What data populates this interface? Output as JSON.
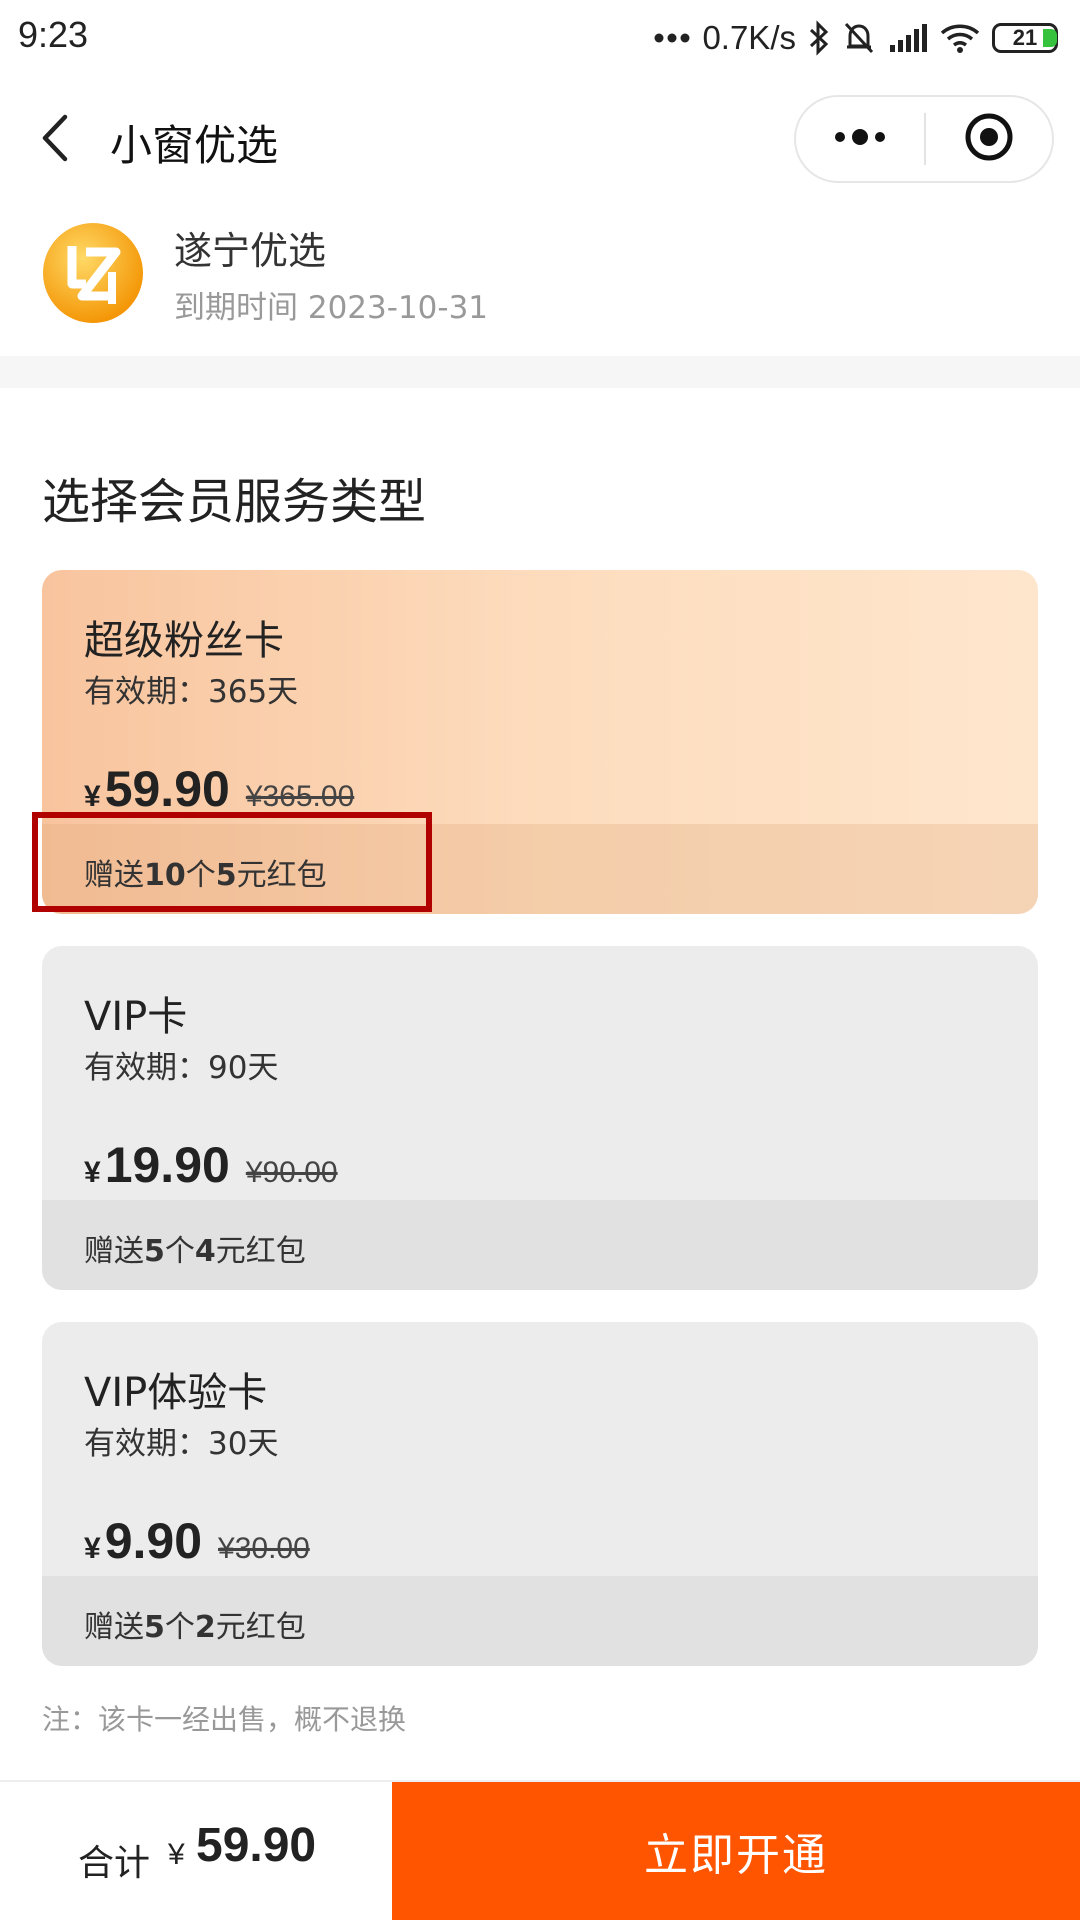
{
  "status_bar": {
    "time": "9:23",
    "network_speed": "0.7K/s",
    "battery_level": "21",
    "icons": [
      "more-dots-icon",
      "bluetooth-icon",
      "mute-icon",
      "signal-icon",
      "wifi-icon",
      "battery-icon"
    ]
  },
  "nav": {
    "title": "小窗优选",
    "back_icon": "chevron-left-icon",
    "more_icon": "more-dots-icon",
    "close_icon": "target-circle-icon"
  },
  "shop": {
    "name": "遂宁优选",
    "expire_label": "到期时间",
    "expire_date": "2023-10-31",
    "logo_colors": [
      "#f9b233",
      "#f39200"
    ]
  },
  "section_title": "选择会员服务类型",
  "cards": [
    {
      "name": "超级粉丝卡",
      "validity": "有效期：365天",
      "currency": "¥",
      "price": "59.90",
      "original_price": "¥365.00",
      "gift": {
        "prefix": "赠送",
        "count": "10",
        "mid": "个",
        "amount": "5",
        "suffix": "元红包"
      },
      "selected": true
    },
    {
      "name": "VIP卡",
      "validity": "有效期：90天",
      "currency": "¥",
      "price": "19.90",
      "original_price": "¥90.00",
      "gift": {
        "prefix": "赠送",
        "count": "5",
        "mid": "个",
        "amount": "4",
        "suffix": "元红包"
      },
      "selected": false
    },
    {
      "name": "VIP体验卡",
      "validity": "有效期：30天",
      "currency": "¥",
      "price": "9.90",
      "original_price": "¥30.00",
      "gift": {
        "prefix": "赠送",
        "count": "5",
        "mid": "个",
        "amount": "2",
        "suffix": "元红包"
      },
      "selected": false
    }
  ],
  "note": "注：该卡一经出售，概不退换",
  "footer": {
    "total_label": "合计",
    "currency": "¥",
    "total": "59.90",
    "button_label": "立即开通"
  },
  "colors": {
    "accent": "#ff5500",
    "highlight_border": "#b00000",
    "selected_card_start": "#f8c49e",
    "selected_card_end": "#fee6cd",
    "card_bg": "#ececec"
  }
}
